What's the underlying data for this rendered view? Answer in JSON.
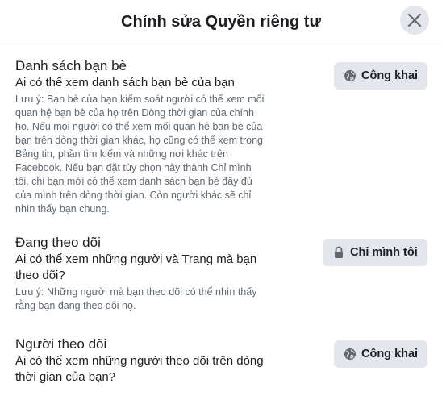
{
  "dialog": {
    "title": "Chỉnh sửa Quyền riêng tư"
  },
  "sections": [
    {
      "title": "Danh sách bạn bè",
      "subtitle": "Ai có thể xem danh sách bạn bè của bạn",
      "note": "Lưu ý: Bạn bè của bạn kiểm soát người có thể xem mối quan hệ bạn bè của họ trên Dòng thời gian của chính họ. Nếu mọi người có thể xem mối quan hệ bạn bè của bạn trên dòng thời gian khác, họ cũng có thể xem trong Bảng tin, phần tìm kiếm và những nơi khác trên Facebook. Nếu bạn đặt tùy chọn này thành Chỉ mình tôi, chỉ bạn mới có thể xem danh sách bạn bè đầy đủ của mình trên dòng thời gian. Còn người khác sẽ chỉ nhìn thấy bạn chung.",
      "button_label": "Công khai",
      "button_icon": "globe-icon"
    },
    {
      "title": "Đang theo dõi",
      "subtitle": "Ai có thể xem những người và Trang mà bạn theo dõi?",
      "note": "Lưu ý: Những người mà bạn theo dõi có thể nhìn thấy rằng bạn đang theo dõi họ.",
      "button_label": "Chỉ mình tôi",
      "button_icon": "lock-icon"
    },
    {
      "title": "Người theo dõi",
      "subtitle": "Ai có thể xem những người theo dõi trên dòng thời gian của bạn?",
      "button_label": "Công khai",
      "button_icon": "globe-icon"
    }
  ],
  "colors": {
    "button_bg": "#e4e6eb",
    "text_primary": "#1c1e21",
    "text_secondary": "#606770",
    "divider": "#dadde1"
  }
}
